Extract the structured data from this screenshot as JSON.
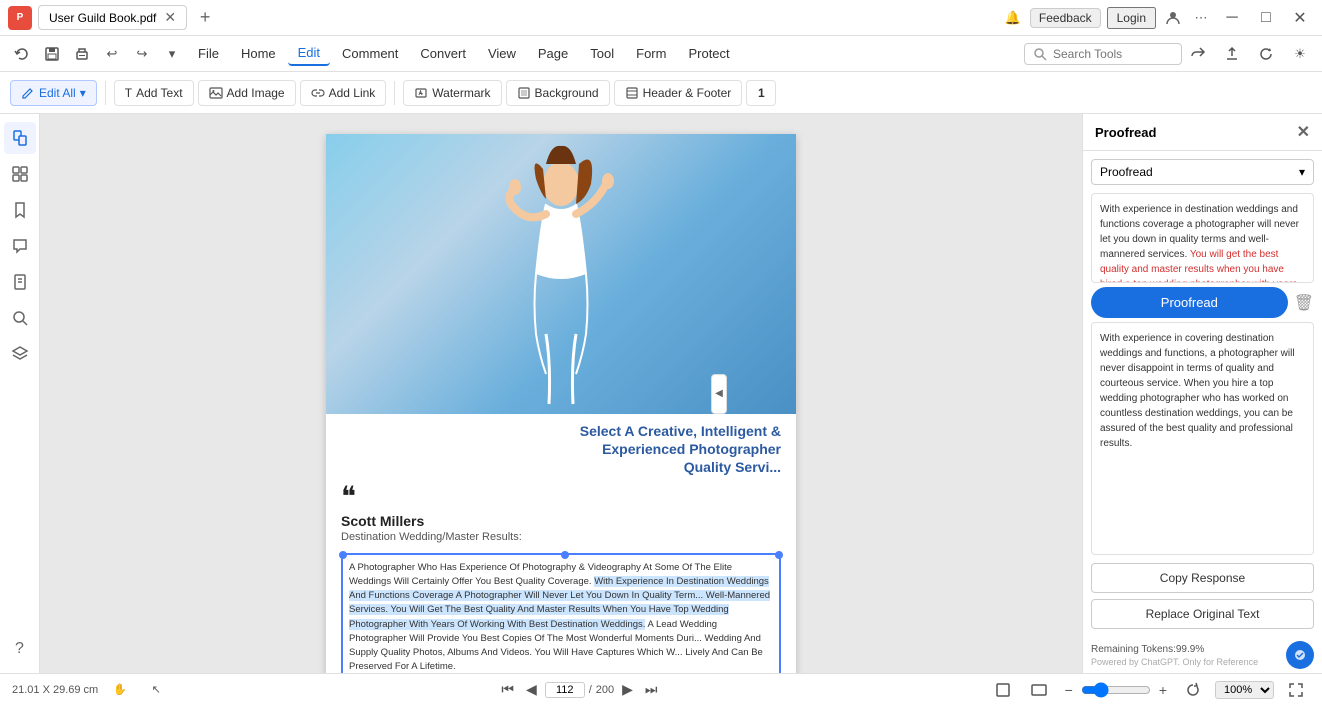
{
  "titleBar": {
    "appName": "PDF",
    "tabTitle": "User Guild Book.pdf",
    "feedbackLabel": "Feedback",
    "loginLabel": "Login"
  },
  "menuBar": {
    "items": [
      {
        "label": "File",
        "id": "file"
      },
      {
        "label": "Home",
        "id": "home"
      },
      {
        "label": "Edit",
        "id": "edit",
        "active": true
      },
      {
        "label": "Comment",
        "id": "comment"
      },
      {
        "label": "Convert",
        "id": "convert"
      },
      {
        "label": "View",
        "id": "view"
      },
      {
        "label": "Page",
        "id": "page"
      },
      {
        "label": "Tool",
        "id": "tool"
      },
      {
        "label": "Form",
        "id": "form"
      },
      {
        "label": "Protect",
        "id": "protect"
      }
    ],
    "searchPlaceholder": "Search Tools"
  },
  "toolbar": {
    "editAllLabel": "Edit All",
    "addTextLabel": "Add Text",
    "addImageLabel": "Add Image",
    "addLinkLabel": "Add Link",
    "watermarkLabel": "Watermark",
    "backgroundLabel": "Background",
    "headerFooterLabel": "Header & Footer"
  },
  "sidebar": {
    "icons": [
      "pages",
      "thumbnails",
      "bookmarks",
      "comments",
      "attachments",
      "search",
      "layers"
    ]
  },
  "pdf": {
    "heading": "Select A Creative, Intelligent &\nExperienced Photographer\nQuality Servi...",
    "quotePerson": "Scott Millers",
    "subtitle": "Destination Wedding/Master Results:",
    "bodyText": "A Photographer Who Has Experience Of Photography & Videography At Some Of The Elite Weddings Will Certainly Offer You Best Quality Coverage. With Experience In Destination Weddings And Functions Coverage A Photographer Will Never Let You Down In Quality Terms Well-Mannered Services. You Will Get The Best Quality And Master Results When You Have Top Wedding Photographer With Years Of Working With Best Destination Weddings. A Lead Wedding Photographer Will Provide You Best Copies Of The Most Wonderful Moments Duri... Wedding And Supply Quality Photos, Albums And Videos. You Will Have Captures Which W... Lively And Can Be Preserved For A Lifetime.",
    "highlightedText": "With Experience In Destination Weddings And Functions Coverage A Photographer Will Never Let You Down In Quality Term... Well-Mannered Services. You Will Get The Best Quality And Master Results When You Have Top Wedding Photographer With Years Of Working With Best Destination Weddings."
  },
  "proofread": {
    "title": "Proofread",
    "selectLabel": "Proofread",
    "originalText": "With experience in destination weddings and functions coverage a photographer will never let you down in quality terms and well-mannered services. You will get the best quality and master results when you have hired a top wedding photographer with years of working with best destination weddings.",
    "proofreadBtnLabel": "Proofread",
    "resultText": "With experience in covering destination weddings and functions, a photographer will never disappoint in terms of quality and courteous service. When you hire a top wedding photographer who has worked on countless destination weddings, you can be assured of the best quality and professional results.",
    "copyResponseLabel": "Copy Response",
    "replaceOriginalLabel": "Replace Original Text",
    "tokensLabel": "Remaining Tokens:99.9%",
    "poweredBy": "Powered by ChatGPT. Only for Reference"
  },
  "statusBar": {
    "dimensions": "21.01 X 29.69 cm",
    "currentPage": "112",
    "totalPages": "200",
    "zoomLevel": "100%"
  }
}
